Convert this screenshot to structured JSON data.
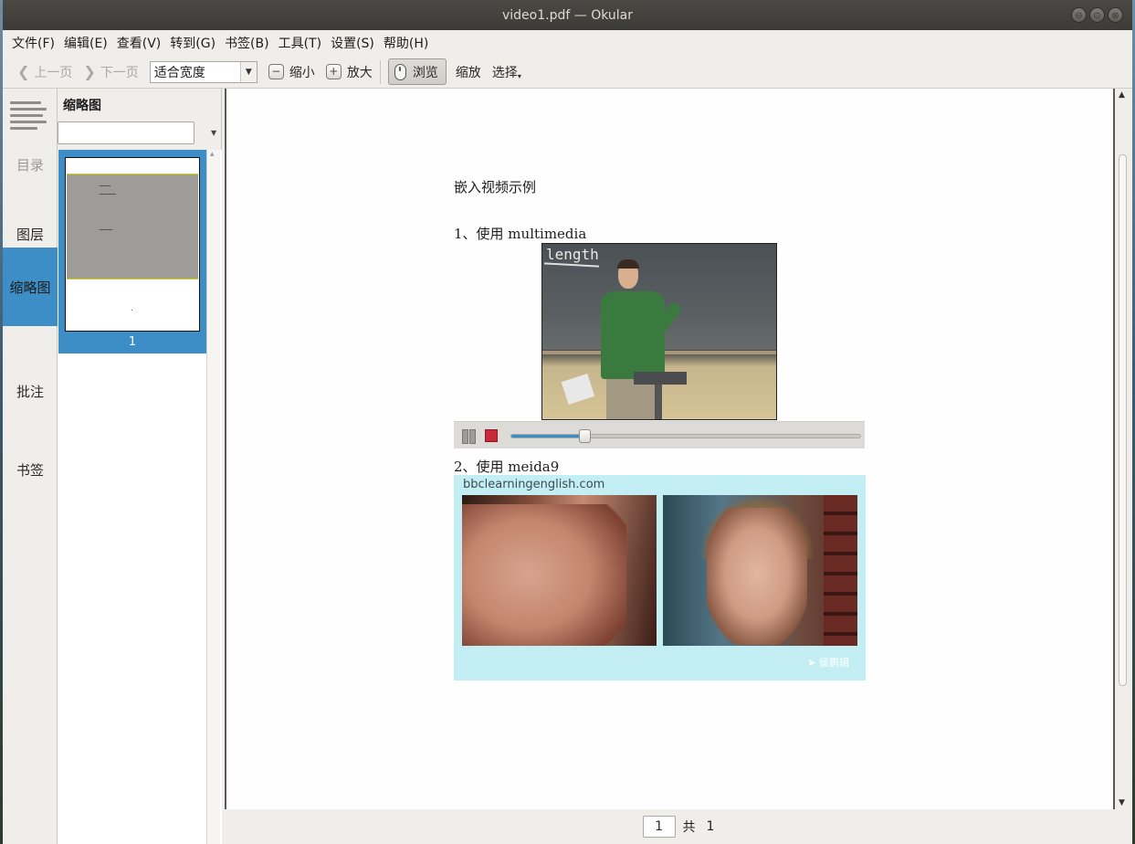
{
  "window": {
    "title": "video1.pdf  — Okular",
    "controls": [
      "⊖",
      "⊙",
      "⊗"
    ]
  },
  "menu": [
    "文件(F)",
    "编辑(E)",
    "查看(V)",
    "转到(G)",
    "书签(B)",
    "工具(T)",
    "设置(S)",
    "帮助(H)"
  ],
  "toolbar": {
    "prev_page": "上一页",
    "next_page": "下一页",
    "zoom_value": "适合宽度",
    "zoom_out": "缩小",
    "zoom_in": "放大",
    "browse": "浏览",
    "zoom_tool": "缩放",
    "select": "选择"
  },
  "sidebar": {
    "menu_icon": "hamburger-lines-icon",
    "items": [
      "目录",
      "图层",
      "缩略图",
      "批注",
      "书签"
    ],
    "active": "缩略图"
  },
  "thumbnails": {
    "title": "缩略图",
    "search_placeholder": "",
    "pages": [
      {
        "number": "1"
      }
    ]
  },
  "document": {
    "heading": "嵌入视频示例",
    "section1": "1、使用 multimedia",
    "section2": "2、使用 meida9",
    "video1": {
      "chalk_text": "length",
      "progress": 0.21
    },
    "video2": {
      "url": "bbclearningenglish.com",
      "brand": "➤ 侯鹏辑"
    }
  },
  "page_nav": {
    "current": "1",
    "of_label": "共",
    "total": "1"
  },
  "colors": {
    "accent": "#3d8dc6",
    "titlebar": "#3c3b37",
    "stop_button": "#c8283a",
    "video2_bg": "#c3eff4"
  }
}
